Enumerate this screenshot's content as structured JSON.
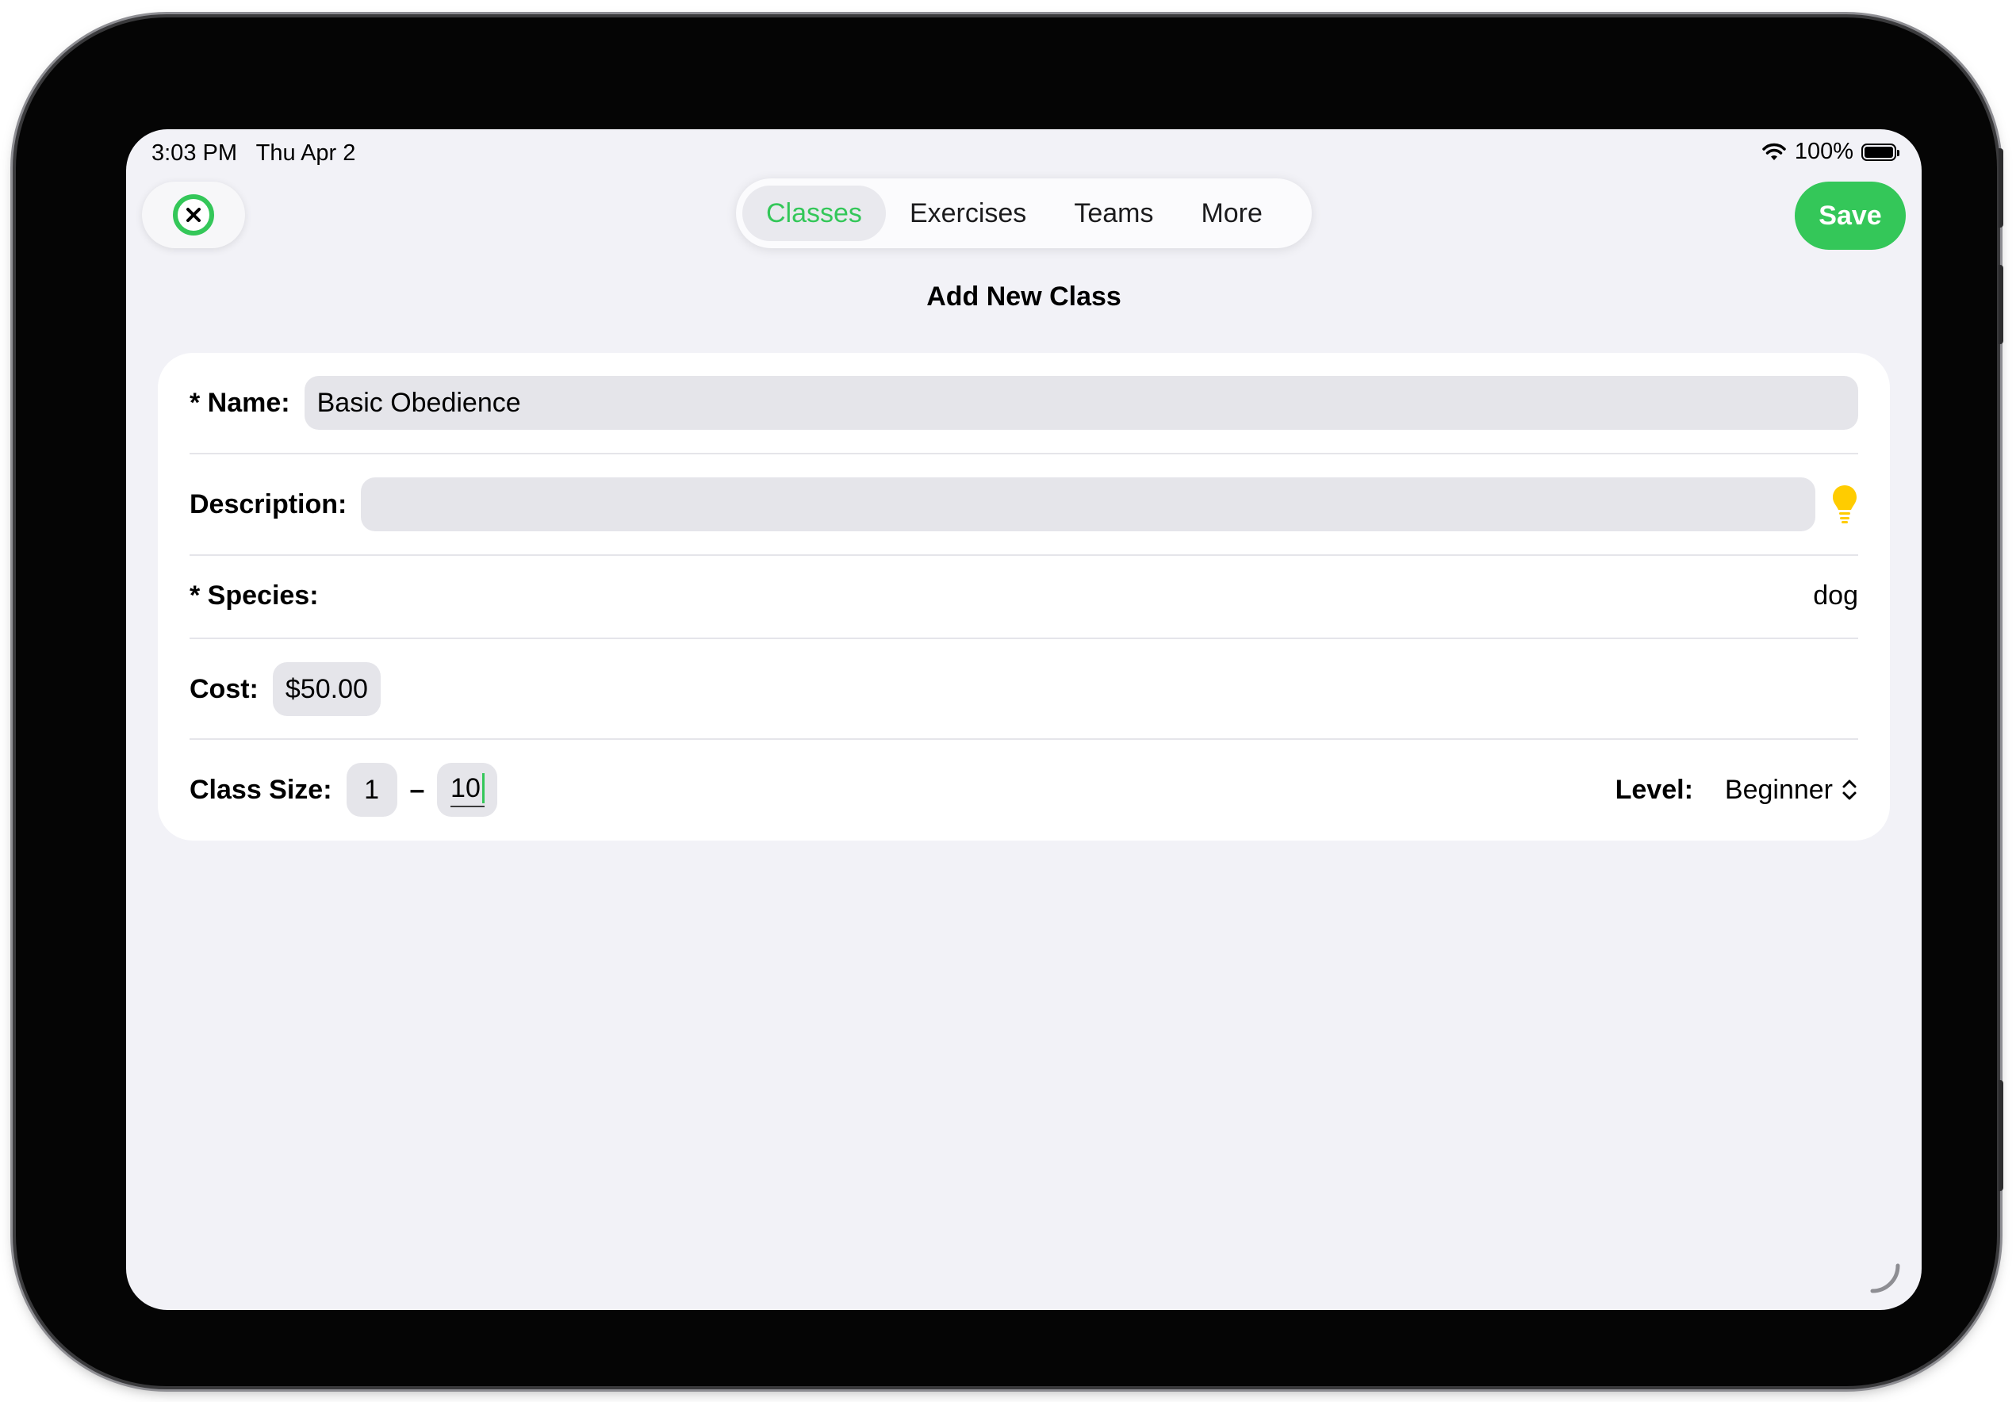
{
  "status_bar": {
    "time": "3:03 PM",
    "date": "Thu Apr 2",
    "battery": "100%",
    "battery_level": 1.0,
    "wifi_icon": "wifi-icon",
    "battery_icon": "battery-icon"
  },
  "toolbar": {
    "close_icon": "close-icon",
    "save_label": "Save",
    "tabs": [
      {
        "label": "Classes",
        "active": true
      },
      {
        "label": "Exercises",
        "active": false
      },
      {
        "label": "Teams",
        "active": false
      },
      {
        "label": "More",
        "active": false
      }
    ]
  },
  "page_title": "Add New Class",
  "form": {
    "name": {
      "label": "* Name:",
      "value": "Basic Obedience"
    },
    "description": {
      "label": "Description:",
      "value": "",
      "hint_icon": "lightbulb-icon"
    },
    "species": {
      "label": "* Species:",
      "value": "dog"
    },
    "cost": {
      "label": "Cost:",
      "value": "$50.00"
    },
    "class_size": {
      "label": "Class Size:",
      "min": "1",
      "separator": "–",
      "max": "10"
    },
    "level": {
      "label": "Level:",
      "value": "Beginner",
      "icon": "chevron-up-down-icon"
    }
  },
  "colors": {
    "accent": "#34c759",
    "background": "#f2f2f7",
    "field": "#e5e5ea",
    "hint": "#ffcc00"
  }
}
